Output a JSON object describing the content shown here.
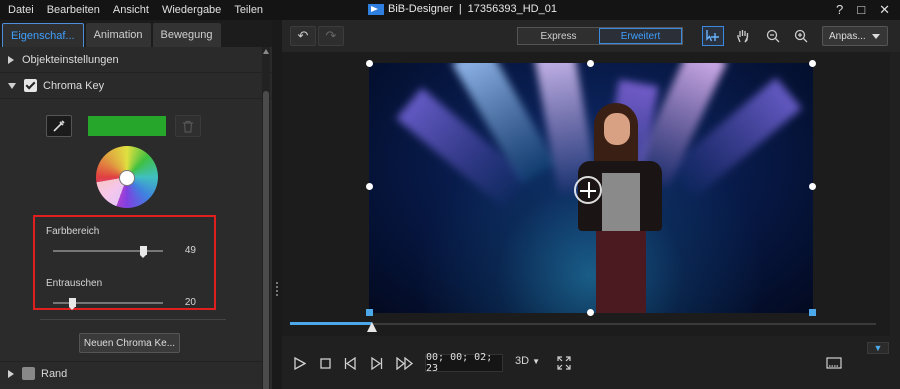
{
  "menu": [
    "Datei",
    "Bearbeiten",
    "Ansicht",
    "Wiedergabe",
    "Teilen"
  ],
  "window": {
    "title": "BiB-Designer",
    "separator": "|",
    "project": "17356393_HD_01",
    "help": "?",
    "maximize": "□",
    "close": "✕"
  },
  "tabs": [
    {
      "label": "Eigenschaf...",
      "active": true
    },
    {
      "label": "Animation",
      "active": false
    },
    {
      "label": "Bewegung",
      "active": false
    }
  ],
  "sections": {
    "objekt": {
      "label": "Objekteinstellungen",
      "expanded": false
    },
    "chroma": {
      "label": "Chroma Key",
      "expanded": true,
      "checked": true
    },
    "rand": {
      "label": "Rand",
      "expanded": false,
      "checked": false
    }
  },
  "chroma_key": {
    "key_color": "#26a62a",
    "sliders": [
      {
        "label": "Farbbereich",
        "value": "49",
        "fraction": 0.82
      },
      {
        "label": "Entrauschen",
        "value": "20",
        "fraction": 0.18
      }
    ],
    "new_button_label": "Neuen Chroma Ke..."
  },
  "toolbar": {
    "undo": "↶",
    "redo": "↷",
    "modes": [
      {
        "label": "Express",
        "active": false
      },
      {
        "label": "Erweitert",
        "active": true
      }
    ],
    "fit_label": "Anpas..."
  },
  "playback": {
    "timecode": "00; 00; 02; 23",
    "mode3d": "3D",
    "progress": 0.14
  },
  "colors": {
    "accent": "#3fa0ff",
    "highlight_box": "#e01f1f",
    "timeline_fill": "#4ca8e8"
  }
}
